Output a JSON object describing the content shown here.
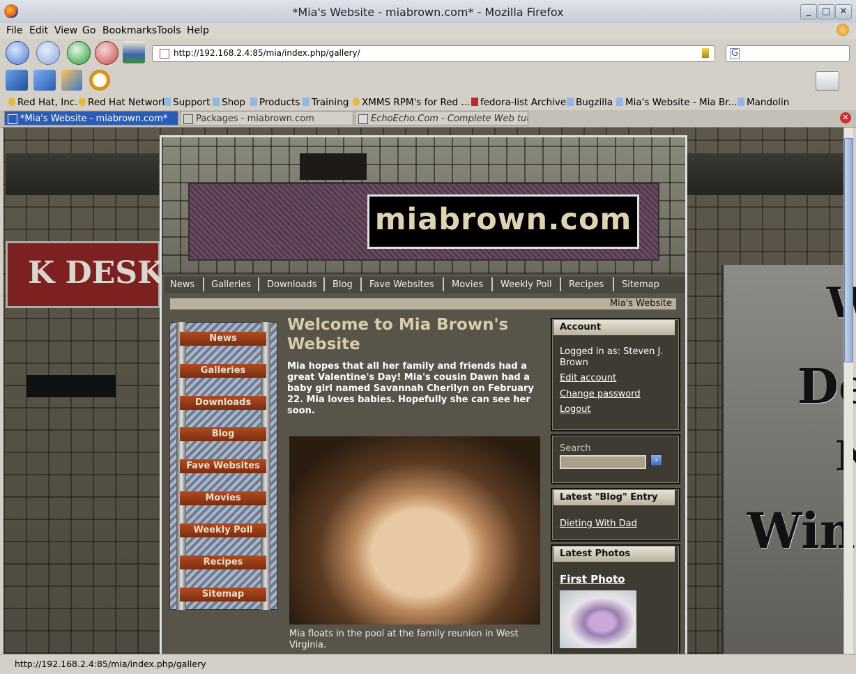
{
  "window": {
    "title": "*Mia's Website - miabrown.com* - Mozilla Firefox",
    "controls": [
      "_",
      "□",
      "✕"
    ]
  },
  "menu": [
    "File",
    "Edit",
    "View",
    "Go",
    "Bookmarks",
    "Tools",
    "Help"
  ],
  "nav": {
    "url": "http://192.168.2.4:85/mia/index.php/gallery/",
    "search_value": "G"
  },
  "bookmarks": [
    "Red Hat, Inc.",
    "Red Hat Network",
    "Support",
    "Shop",
    "Products",
    "Training",
    "XMMS RPM's for Red ...",
    "fedora-list Archives",
    "Bugzilla",
    "Mia's Website - Mia Br...",
    "Mandolin"
  ],
  "tabs": [
    {
      "label": "*Mia's Website - miabrown.com*",
      "active": true
    },
    {
      "label": "Packages - miabrown.com",
      "active": false
    },
    {
      "label": "EchoEcho.Com - Complete Web tut...",
      "active": false
    }
  ],
  "site": {
    "logo": "miabrown.com",
    "top_nav": [
      "News",
      "Galleries",
      "Downloads",
      "Blog",
      "Fave Websites",
      "Movies",
      "Weekly Poll",
      "Recipes",
      "Sitemap"
    ],
    "site_bar": "Mia's Website",
    "left_nav": [
      "News",
      "Galleries",
      "Downloads",
      "Blog",
      "Fave Websites",
      "Movies",
      "Weekly Poll",
      "Recipes",
      "Sitemap"
    ],
    "main": {
      "title": "Welcome to Mia Brown's Website",
      "intro": "Mia hopes that all her family and friends had a great Valentine's Day! Mia's cousin Dawn had a baby girl named Savannah Cherilyn on February 22. Mia loves babies. Hopefully she can see her soon.",
      "caption": "Mia floats in the pool at the family reunion in West Virginia."
    },
    "account": {
      "heading": "Account",
      "logged_in": "Logged in as: Steven J. Brown",
      "links": [
        "Edit account",
        "Change password",
        "Logout"
      ]
    },
    "search": {
      "label": "Search",
      "button": "›"
    },
    "blog": {
      "heading": "Latest \"Blog\" Entry",
      "entry": "Dieting With Dad"
    },
    "photos": {
      "heading": "Latest Photos",
      "first_photo": "First Photo"
    }
  },
  "background_text": {
    "left_sign": "K DESK",
    "right_letters": [
      "W",
      "De",
      "N",
      "Win"
    ]
  },
  "status": "http://192.168.2.4:85/mia/index.php/gallery",
  "colors": {
    "tab_active": "#2a5cb5",
    "logo_text": "#e0d3b3",
    "title_text": "#d8ccab"
  }
}
